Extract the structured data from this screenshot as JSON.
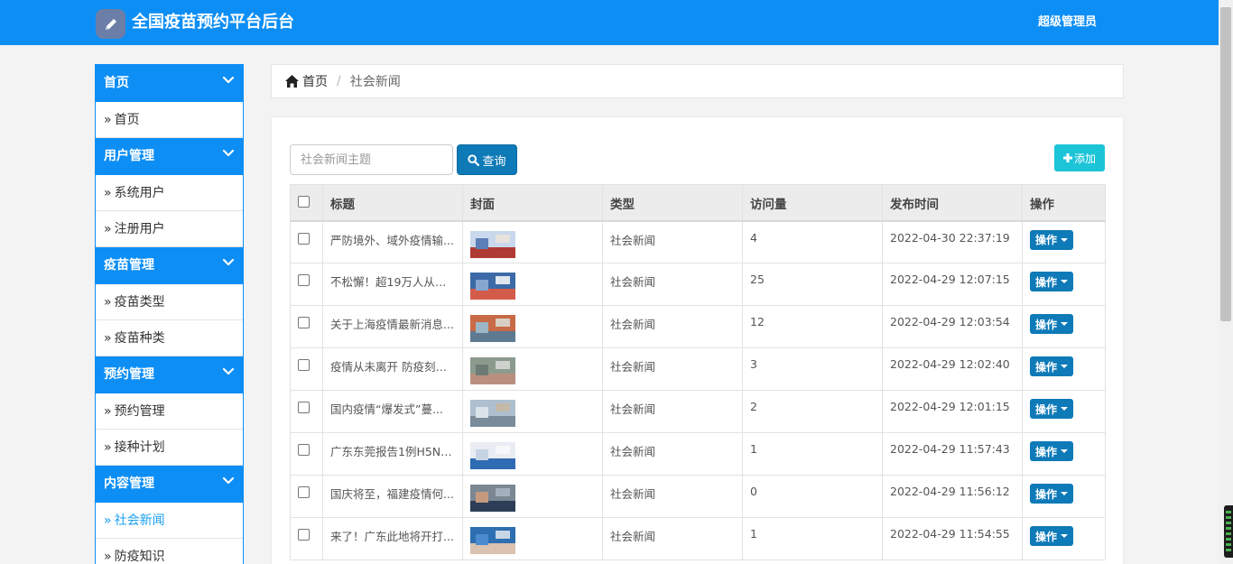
{
  "header": {
    "app_title": "全国疫苗预约平台后台",
    "user": "超级管理员",
    "logo_icon": "pencil-icon"
  },
  "sidebar": {
    "groups": [
      {
        "label": "首页",
        "items": [
          "首页"
        ]
      },
      {
        "label": "用户管理",
        "items": [
          "系统用户",
          "注册用户"
        ]
      },
      {
        "label": "疫苗管理",
        "items": [
          "疫苗类型",
          "疫苗种类"
        ]
      },
      {
        "label": "预约管理",
        "items": [
          "预约管理",
          "接种计划"
        ]
      },
      {
        "label": "内容管理",
        "items": [
          "社会新闻",
          "防疫知识"
        ]
      }
    ],
    "active_item": "社会新闻",
    "item_prefix": "»"
  },
  "breadcrumb": {
    "home": "首页",
    "current": "社会新闻"
  },
  "toolbar": {
    "search_placeholder": "社会新闻主题",
    "search_label": "查询",
    "add_label": "添加"
  },
  "table": {
    "columns": [
      "标题",
      "封面",
      "类型",
      "访问量",
      "发布时间",
      "操作"
    ],
    "rows": [
      {
        "title": "严防境外、域外疫情输...",
        "type": "社会新闻",
        "visits": "4",
        "time": "2022-04-30 22:37:19",
        "action": "操作"
      },
      {
        "title": "不松懈！超19万人从福...",
        "type": "社会新闻",
        "visits": "25",
        "time": "2022-04-29 12:07:15",
        "action": "操作"
      },
      {
        "title": "关于上海疫情最新消息...",
        "type": "社会新闻",
        "visits": "12",
        "time": "2022-04-29 12:03:54",
        "action": "操作"
      },
      {
        "title": "疫情从未离开 防疫刻不...",
        "type": "社会新闻",
        "visits": "3",
        "time": "2022-04-29 12:02:40",
        "action": "操作"
      },
      {
        "title": "国内疫情“爆发式”蔓...",
        "type": "社会新闻",
        "visits": "2",
        "time": "2022-04-29 12:01:15",
        "action": "操作"
      },
      {
        "title": "广东东莞报告1例H5N6...",
        "type": "社会新闻",
        "visits": "1",
        "time": "2022-04-29 11:57:43",
        "action": "操作"
      },
      {
        "title": "国庆将至，福建疫情何...",
        "type": "社会新闻",
        "visits": "0",
        "time": "2022-04-29 11:56:12",
        "action": "操作"
      },
      {
        "title": "来了！广东此地将开打...",
        "type": "社会新闻",
        "visits": "1",
        "time": "2022-04-29 11:54:55",
        "action": "操作"
      }
    ]
  },
  "colors": {
    "primary": "#0d8ef5",
    "button": "#0e7ab8",
    "add": "#1cc4d8",
    "active_link": "#1a9ff0"
  }
}
